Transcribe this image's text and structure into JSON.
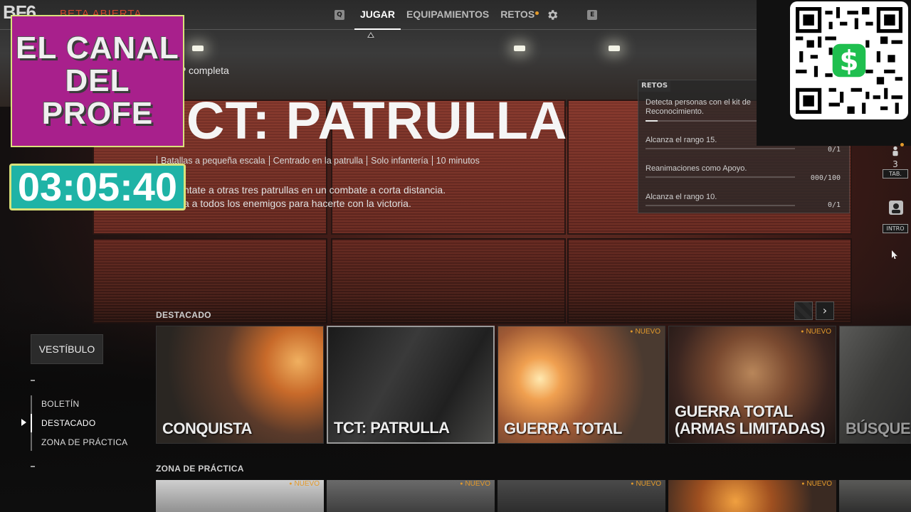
{
  "header": {
    "logo": "BF6",
    "beta_label": "BETA ABIERTA",
    "key_left": "Q",
    "key_right": "E",
    "tabs": [
      {
        "label": "JUGAR",
        "active": true
      },
      {
        "label": "EQUIPAMIENTOS",
        "active": false
      },
      {
        "label": "RETOS",
        "active": false,
        "notification": true
      }
    ],
    "settings_icon": "gear-icon"
  },
  "overlay": {
    "channel_lines": [
      "EL CANAL",
      "DEL",
      "PROFE"
    ],
    "timer": "03:05:40",
    "qr_icon": "cash-app-dollar-icon"
  },
  "hero": {
    "subtitle": "P completa",
    "title": "CT: PATRULLA",
    "tags": [
      "Batallas a pequeña escala",
      "Centrado en la patrulla",
      "Solo infantería",
      "10 minutos"
    ],
    "description_lines": [
      "ntate a otras tres patrullas en un combate a corta distancia.",
      "a a todos los enemigos para hacerte con la victoria."
    ]
  },
  "retos": {
    "header": "RETOS",
    "items": [
      {
        "text": "Detecta personas con el kit de Reconocimiento.",
        "count": "",
        "progress": 0.08
      },
      {
        "text": "Alcanza el rango 15.",
        "count": "0/1",
        "progress": 0.0
      },
      {
        "text": "Reanimaciones como Apoyo.",
        "count": "000/100",
        "progress": 0.0
      },
      {
        "text": "Alcanza el rango 10.",
        "count": "0/1",
        "progress": 0.0
      }
    ]
  },
  "side_panel": {
    "squad_count": "3",
    "squad_key": "TAB.",
    "profile_key": "INTRO"
  },
  "sidebar": {
    "lobby_label": "VESTÍBULO",
    "items": [
      {
        "label": "BOLETÍN",
        "active": false
      },
      {
        "label": "DESTACADO",
        "active": true
      },
      {
        "label": "ZONA DE PRÁCTICA",
        "active": false
      }
    ]
  },
  "featured": {
    "section_label": "DESTACADO",
    "cards": [
      {
        "label": "CONQUISTA",
        "badge": "",
        "selected": false
      },
      {
        "label": "TCT: PATRULLA",
        "badge": "",
        "selected": true
      },
      {
        "label": "GUERRA TOTAL",
        "badge": "NUEVO",
        "selected": false
      },
      {
        "label": "GUERRA TOTAL (ARMAS LIMITADAS)",
        "badge": "NUEVO",
        "selected": false
      },
      {
        "label": "BÚSQUEDA",
        "badge": "",
        "selected": false
      }
    ]
  },
  "practice": {
    "section_label": "ZONA DE PRÁCTICA",
    "cards": [
      {
        "badge": "NUEVO"
      },
      {
        "badge": "NUEVO"
      },
      {
        "badge": "NUEVO"
      },
      {
        "badge": "NUEVO"
      },
      {
        "badge": ""
      }
    ]
  },
  "colors": {
    "accent_orange": "#e39a2b",
    "beta_red": "#d2452c",
    "brand_magenta": "#a8208c",
    "timer_teal": "#1fb3a6",
    "brand_border": "#d9e27b"
  }
}
